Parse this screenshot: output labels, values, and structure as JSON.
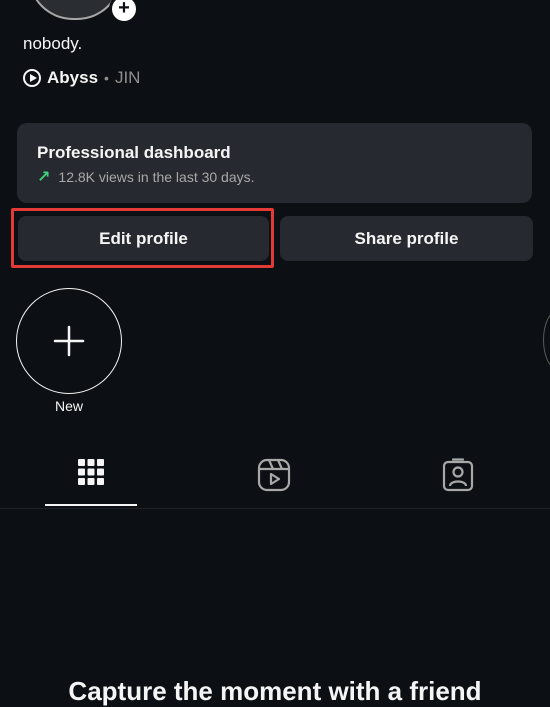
{
  "profile": {
    "bio": "nobody.",
    "avatar_add_icon": "plus-icon"
  },
  "music": {
    "icon": "play-circle-icon",
    "song": "Abyss",
    "separator": "•",
    "artist": "JIN"
  },
  "dashboard": {
    "title": "Professional dashboard",
    "trend_icon": "trend-up-arrow-icon",
    "stat": "12.8K views in the last 30 days."
  },
  "actions": {
    "edit_label": "Edit profile",
    "share_label": "Share profile"
  },
  "highlights": {
    "new_icon": "plus-icon",
    "new_label": "New"
  },
  "tabs": [
    {
      "icon": "grid-icon",
      "active": true
    },
    {
      "icon": "reels-icon",
      "active": false
    },
    {
      "icon": "tagged-person-icon",
      "active": false
    }
  ],
  "empty_state": {
    "title": "Capture the moment with a friend"
  },
  "colors": {
    "background": "#0c1014",
    "surface": "#262a30",
    "text": "#f5f5f5",
    "muted": "#8e8e8e",
    "trend_green": "#3dd17a",
    "highlight_red": "#e53935"
  }
}
